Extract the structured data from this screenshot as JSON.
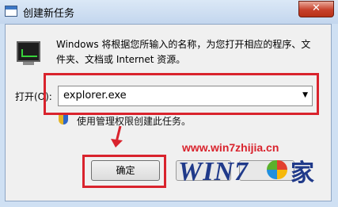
{
  "window": {
    "title": "创建新任务",
    "close_label": "✕"
  },
  "dialog": {
    "description": "Windows 将根据您所输入的名称，为您打开相应的程序、文件夹、文档或 Internet 资源。",
    "open_label": "打开(O):",
    "input_value": "explorer.exe",
    "admin_note": "使用管理权限创建此任务。",
    "ok_label": "确定"
  },
  "watermark": {
    "url": "www.win7zhijia.cn",
    "logo_text": "WIN7",
    "logo_char": "家"
  },
  "colors": {
    "highlight_red": "#d9232d",
    "title_bar": "#cfe0f3"
  }
}
